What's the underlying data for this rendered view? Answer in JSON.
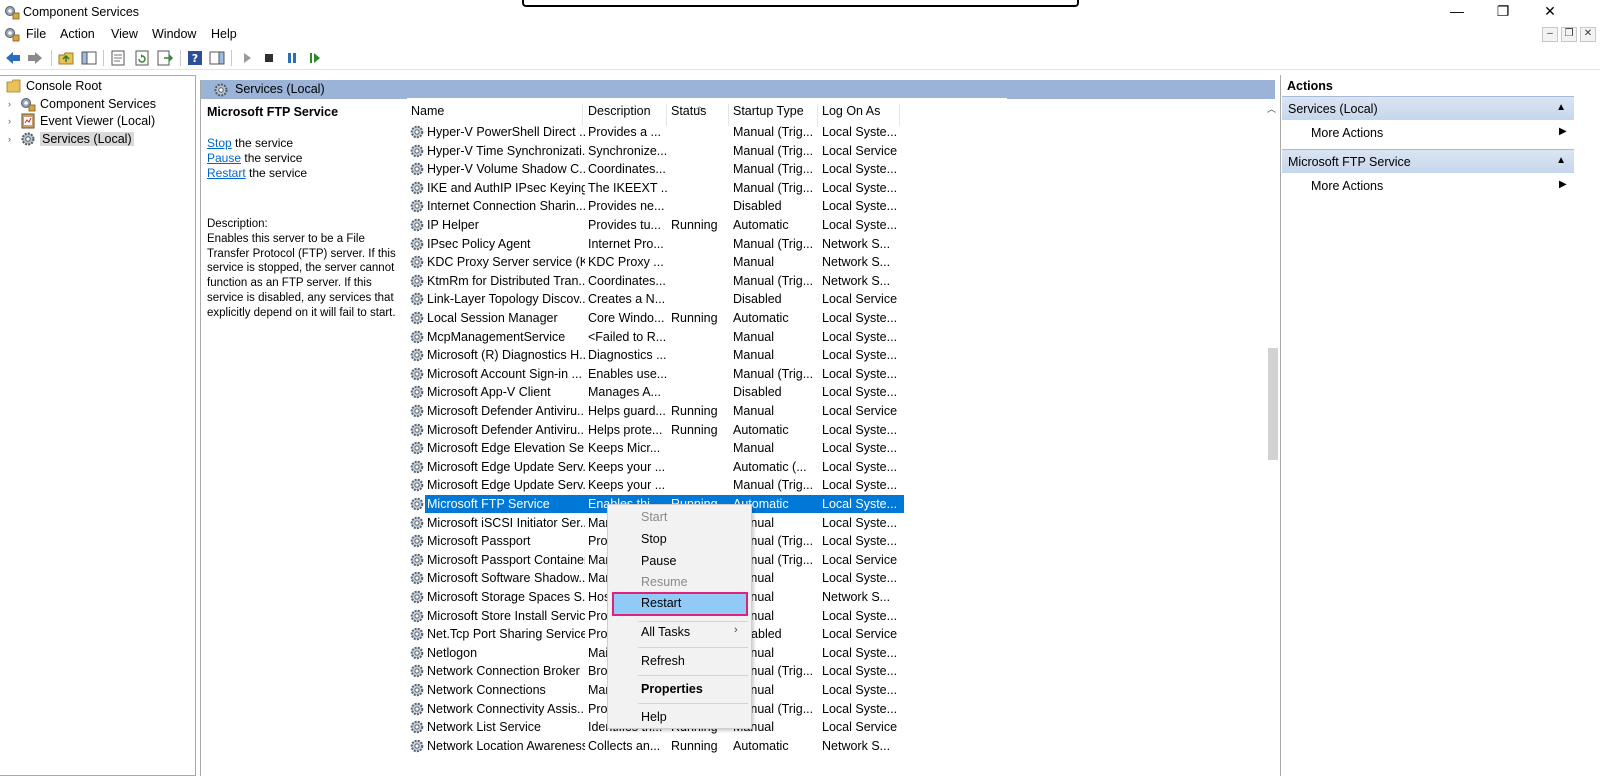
{
  "window": {
    "title": "Component Services",
    "controls": [
      "—",
      "❐",
      "✕"
    ]
  },
  "menu": [
    "File",
    "Action",
    "View",
    "Window",
    "Help"
  ],
  "tree": {
    "items": [
      {
        "label": "Console Root",
        "icon": "folder-icon"
      },
      {
        "label": "Component Services",
        "icon": "component-services-icon"
      },
      {
        "label": "Event Viewer (Local)",
        "icon": "event-viewer-icon"
      },
      {
        "label": "Services (Local)",
        "icon": "services-gear-icon"
      }
    ]
  },
  "middle": {
    "header": "Services (Local)",
    "details": {
      "title": "Microsoft FTP Service",
      "stop_link": "Stop",
      "stop_rest": " the service",
      "pause_link": "Pause",
      "pause_rest": " the service",
      "restart_link": "Restart",
      "restart_rest": " the service",
      "desc_label": "Description:",
      "description": "Enables this server to be a File Transfer Protocol (FTP) server. If this service is stopped, the server cannot function as an FTP server. If this service is disabled, any services that explicitly depend on it will fail to start."
    },
    "columns": [
      "Name",
      "Description",
      "Status",
      "Startup Type",
      "Log On As"
    ],
    "rows": [
      [
        "Hyper-V PowerShell Direct ...",
        "Provides a ...",
        "",
        "Manual (Trig...",
        "Local Syste..."
      ],
      [
        "Hyper-V Time Synchronizati...",
        "Synchronize...",
        "",
        "Manual (Trig...",
        "Local Service"
      ],
      [
        "Hyper-V Volume Shadow C...",
        "Coordinates...",
        "",
        "Manual (Trig...",
        "Local Syste..."
      ],
      [
        "IKE and AuthIP IPsec Keying...",
        "The IKEEXT ...",
        "",
        "Manual (Trig...",
        "Local Syste..."
      ],
      [
        "Internet Connection Sharin...",
        "Provides ne...",
        "",
        "Disabled",
        "Local Syste..."
      ],
      [
        "IP Helper",
        "Provides tu...",
        "Running",
        "Automatic",
        "Local Syste..."
      ],
      [
        "IPsec Policy Agent",
        "Internet Pro...",
        "",
        "Manual (Trig...",
        "Network S..."
      ],
      [
        "KDC Proxy Server service (K...",
        "KDC Proxy ...",
        "",
        "Manual",
        "Network S..."
      ],
      [
        "KtmRm for Distributed Tran...",
        "Coordinates...",
        "",
        "Manual (Trig...",
        "Network S..."
      ],
      [
        "Link-Layer Topology Discov...",
        "Creates a N...",
        "",
        "Disabled",
        "Local Service"
      ],
      [
        "Local Session Manager",
        "Core Windo...",
        "Running",
        "Automatic",
        "Local Syste..."
      ],
      [
        "McpManagementService",
        "<Failed to R...",
        "",
        "Manual",
        "Local Syste..."
      ],
      [
        "Microsoft (R) Diagnostics H...",
        "Diagnostics ...",
        "",
        "Manual",
        "Local Syste..."
      ],
      [
        "Microsoft Account Sign-in ...",
        "Enables use...",
        "",
        "Manual (Trig...",
        "Local Syste..."
      ],
      [
        "Microsoft App-V Client",
        "Manages A...",
        "",
        "Disabled",
        "Local Syste..."
      ],
      [
        "Microsoft Defender Antiviru...",
        "Helps guard...",
        "Running",
        "Manual",
        "Local Service"
      ],
      [
        "Microsoft Defender Antiviru...",
        "Helps prote...",
        "Running",
        "Automatic",
        "Local Syste..."
      ],
      [
        "Microsoft Edge Elevation Se...",
        "Keeps Micr...",
        "",
        "Manual",
        "Local Syste..."
      ],
      [
        "Microsoft Edge Update Serv...",
        "Keeps your ...",
        "",
        "Automatic (...",
        "Local Syste..."
      ],
      [
        "Microsoft Edge Update Serv...",
        "Keeps your ...",
        "",
        "Manual (Trig...",
        "Local Syste..."
      ],
      [
        "Microsoft FTP Service",
        "Enables thi...",
        "Running",
        "Automatic",
        "Local Syste..."
      ],
      [
        "Microsoft iSCSI Initiator Ser...",
        "Manages In...",
        "",
        "Manual",
        "Local Syste..."
      ],
      [
        "Microsoft Passport",
        "Provides pr...",
        "",
        "Manual (Trig...",
        "Local Syste..."
      ],
      [
        "Microsoft Passport Container",
        "Manages lo...",
        "",
        "Manual (Trig...",
        "Local Service"
      ],
      [
        "Microsoft Software Shadow...",
        "Manages so...",
        "",
        "Manual",
        "Local Syste..."
      ],
      [
        "Microsoft Storage Spaces S...",
        "Host servic...",
        "",
        "Manual",
        "Network S..."
      ],
      [
        "Microsoft Store Install Service",
        "Provides inf...",
        "",
        "Manual",
        "Local Syste..."
      ],
      [
        "Net.Tcp Port Sharing Service",
        "Provides abi...",
        "",
        "Disabled",
        "Local Service"
      ],
      [
        "Netlogon",
        "Maintains a ...",
        "",
        "Manual",
        "Local Syste..."
      ],
      [
        "Network Connection Broker",
        "Brokers con...",
        "",
        "Manual (Trig...",
        "Local Syste..."
      ],
      [
        "Network Connections",
        "Manages o...",
        "",
        "Manual",
        "Local Syste..."
      ],
      [
        "Network Connectivity Assis...",
        "Provides Dir...",
        "",
        "Manual (Trig...",
        "Local Syste..."
      ],
      [
        "Network List Service",
        "Identifies th...",
        "Running",
        "Manual",
        "Local Service"
      ],
      [
        "Network Location Awareness",
        "Collects an...",
        "Running",
        "Automatic",
        "Network S..."
      ]
    ],
    "selected_row": "Microsoft FTP Service"
  },
  "actions": {
    "title": "Actions",
    "sections": [
      {
        "label": "Services (Local)",
        "item": "More Actions"
      },
      {
        "label": "Microsoft FTP Service",
        "item": "More Actions"
      }
    ]
  },
  "context_menu": {
    "start": "Start",
    "stop": "Stop",
    "pause": "Pause",
    "resume": "Resume",
    "restart": "Restart",
    "all_tasks": "All Tasks",
    "refresh": "Refresh",
    "properties": "Properties",
    "help": "Help"
  },
  "colors": {
    "selection": "#0078d7",
    "header_band": "#9ab3d6",
    "link": "#0066cc",
    "highlight_border": "#e0217a",
    "menu_hover": "#91c9f7"
  }
}
